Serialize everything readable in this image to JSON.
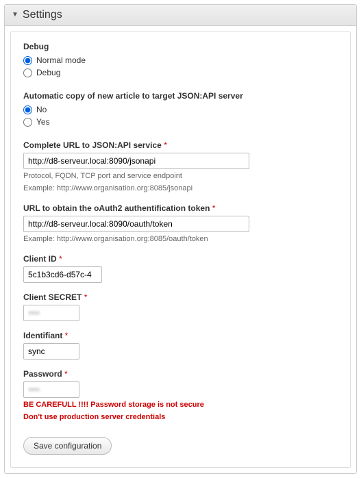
{
  "panel": {
    "title": "Settings"
  },
  "debug": {
    "title": "Debug",
    "options": {
      "normal": "Normal mode",
      "debug": "Debug"
    },
    "selected": "normal"
  },
  "autocopy": {
    "title": "Automatic copy of new article to target JSON:API server",
    "options": {
      "no": "No",
      "yes": "Yes"
    },
    "selected": "no"
  },
  "url_jsonapi": {
    "label": "Complete URL to JSON:API service",
    "value": "http://d8-serveur.local:8090/jsonapi",
    "desc1": "Protocol, FQDN, TCP port and service endpoint",
    "desc2": "Example: http://www.organisation.org:8085/jsonapi"
  },
  "url_oauth": {
    "label": "URL to obtain the oAuth2 authentification token",
    "value": "http://d8-serveur.local:8090/oauth/token",
    "desc1": "Example: http://www.organisation.org:8085/oauth/token"
  },
  "client_id": {
    "label": "Client ID",
    "value": "5c1b3cd6-d57c-4"
  },
  "client_secret": {
    "label": "Client SECRET",
    "value": "••••"
  },
  "identifiant": {
    "label": "Identifiant",
    "value": "sync"
  },
  "password": {
    "label": "Password",
    "value": "••••",
    "warn1": "BE CAREFULL !!!! Password storage is not secure",
    "warn2": "Don't use production server credentials"
  },
  "actions": {
    "save": "Save configuration"
  },
  "required_marker": "*"
}
